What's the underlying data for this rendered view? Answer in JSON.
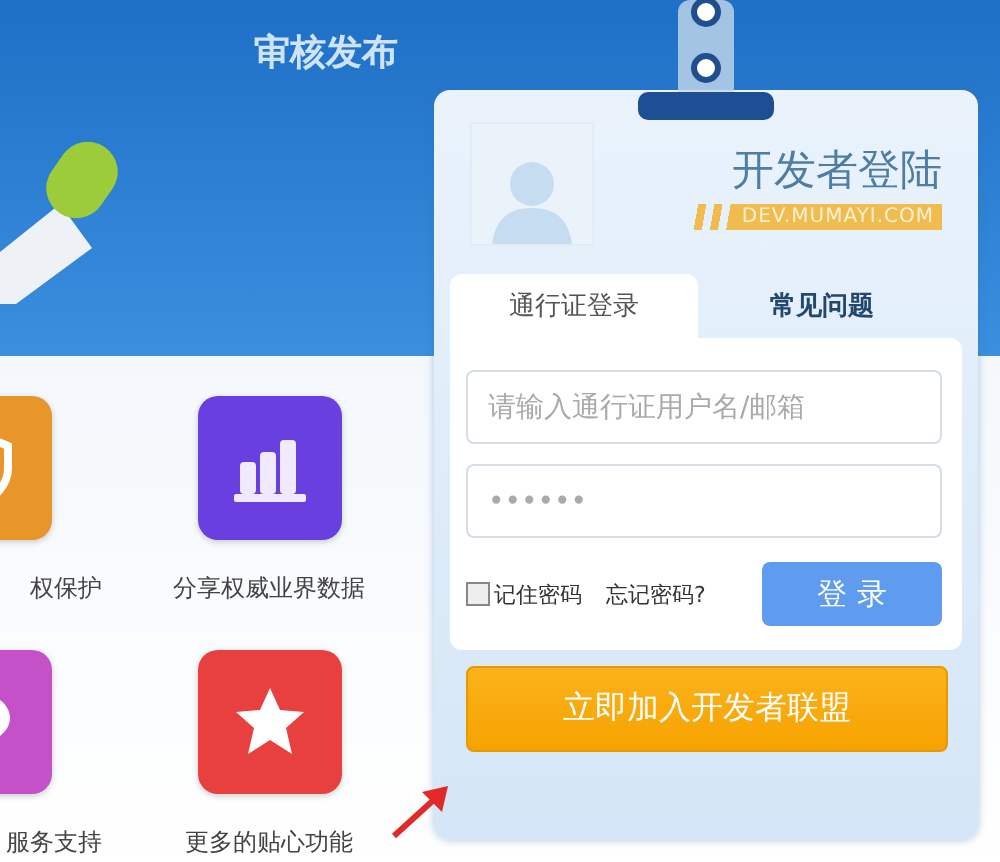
{
  "banner": {
    "headline": [
      "审核发布"
    ]
  },
  "features": [
    {
      "label": "权保护",
      "kind": "shield",
      "color": "#e8962a"
    },
    {
      "label": "分享权威业界数据",
      "kind": "chart",
      "color": "#6a3fe0"
    },
    {
      "label": "服务支持",
      "kind": "chat",
      "color": "#c451c8"
    },
    {
      "label": "更多的贴心功能",
      "kind": "star",
      "color": "#e8403f"
    }
  ],
  "login_card": {
    "title": "开发者登陆",
    "domain": "DEV.MUMAYI.COM",
    "tabs": [
      {
        "label": "通行证登录",
        "selected": true
      },
      {
        "label": "常见问题",
        "selected": false
      }
    ],
    "username": {
      "placeholder": "请输入通行证用户名/邮箱"
    },
    "password": {
      "placeholder": "••••••"
    },
    "remember": {
      "label": "记住密码",
      "checked": false
    },
    "forgot_link": "忘记密码?",
    "login_button": "登 录",
    "join_button": "立即加入开发者联盟"
  }
}
